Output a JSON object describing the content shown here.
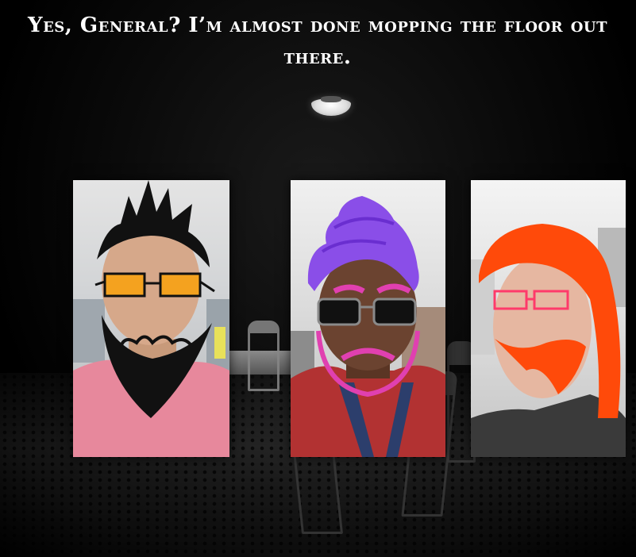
{
  "dialog": {
    "text": "Yes, General? I’m almost done mopping the floor out there."
  },
  "scene": {
    "setting": "dark-room-with-tiled-floor",
    "light_icon": "ceiling-lamp-icon"
  },
  "characters": [
    {
      "id": "left",
      "hair_color": "#111111",
      "glasses_color": "#f4a21f",
      "beard_color": "#111111",
      "shirt_color": "#e7889c"
    },
    {
      "id": "middle",
      "hair_color": "#8a4ee8",
      "glasses_color": "#111111",
      "accent_color": "#e040b0",
      "shirt_color": "#b23232"
    },
    {
      "id": "right",
      "hair_color": "#ff4a0a",
      "glasses_color": "#ff3a6a",
      "beard_color": "#ff4a0a",
      "shirt_color": "#3a3a3a"
    }
  ]
}
